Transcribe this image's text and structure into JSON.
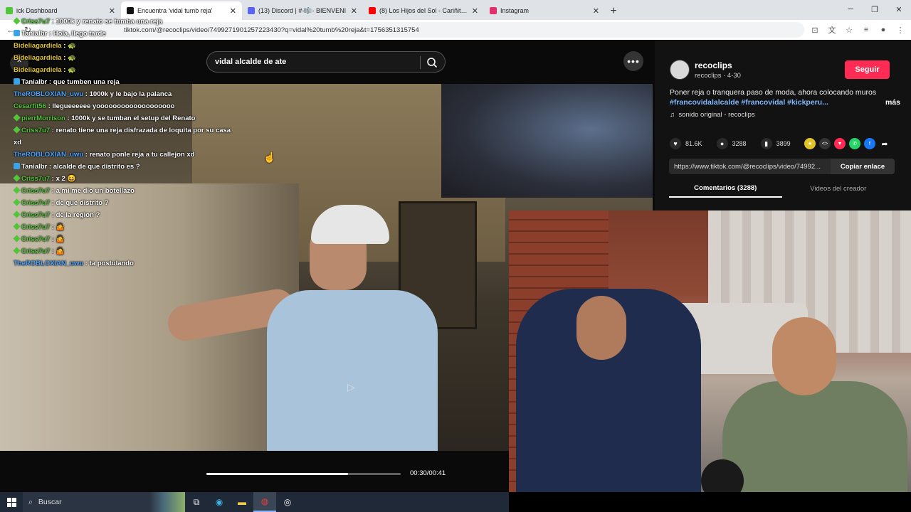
{
  "browser": {
    "tabs": [
      {
        "title": "ick Dashboard",
        "icon_color": "#53c53a",
        "active": false
      },
      {
        "title": "Encuentra 'vidal tumb reja'",
        "icon_color": "#111111",
        "active": true
      },
      {
        "title": "(13) Discord | #-🎼- BIENVENI",
        "icon_color": "#5865f2",
        "active": false
      },
      {
        "title": "(8) Los Hijos del Sol - Cariñito -",
        "icon_color": "#ff0000",
        "active": false
      },
      {
        "title": "Instagram",
        "icon_color": "#e1306c",
        "active": false
      }
    ],
    "url": "tiktok.com/@recoclips/video/7499271901257223430?q=vidal%20tumb%20reja&t=1756351315754"
  },
  "search": {
    "query": "vidal alcalde de ate"
  },
  "chat": [
    {
      "user": "Criss7u7",
      "text": "1000k y renato se tumba una reja",
      "user_color": "#53c53a",
      "badge": "g"
    },
    {
      "user": "Tanialbr",
      "text": "Hola, llego tarde",
      "user_color": "#ffffff",
      "badge": "b"
    },
    {
      "user": "Bideliagardiela",
      "text": "🐢",
      "user_color": "#e2c229",
      "badge": ""
    },
    {
      "user": "Bideliagardiela",
      "text": "🐢",
      "user_color": "#e2c229",
      "badge": ""
    },
    {
      "user": "Bideliagardiela",
      "text": "🐢",
      "user_color": "#e2c229",
      "badge": ""
    },
    {
      "user": "Tanialbr",
      "text": "que tumben una reja",
      "user_color": "#ffffff",
      "badge": "b"
    },
    {
      "user": "TheROBLOXIAN_uwu",
      "text": "1000k y le bajo la palanca",
      "user_color": "#4aa3ff",
      "badge": ""
    },
    {
      "user": "Cesarfit56",
      "text": "llegueeeeee yooooooooooooooooooo",
      "user_color": "#53c53a",
      "badge": ""
    },
    {
      "user": "pierrMorrison",
      "text": "1000k y se tumban el setup del Renato",
      "user_color": "#53c53a",
      "badge": "g"
    },
    {
      "user": "Criss7u7",
      "text": "renato tiene una reja disfrazada de loquita por su casa xd",
      "user_color": "#53c53a",
      "badge": "g"
    },
    {
      "user": "TheROBLOXIAN_uwu",
      "text": "renato ponle reja a tu callejon xd",
      "user_color": "#4aa3ff",
      "badge": ""
    },
    {
      "user": "Tanialbr",
      "text": "alcalde de que distrito es ?",
      "user_color": "#ffffff",
      "badge": "b"
    },
    {
      "user": "Criss7u7",
      "text": "x 2 😆",
      "user_color": "#53c53a",
      "badge": "g"
    },
    {
      "user": "Criss7u7",
      "text": "a mi me dio un botellazo",
      "user_color": "#53c53a",
      "badge": "g"
    },
    {
      "user": "Criss7u7",
      "text": "de que distrito ?",
      "user_color": "#53c53a",
      "badge": "g"
    },
    {
      "user": "Criss7u7",
      "text": "de la region ?",
      "user_color": "#53c53a",
      "badge": "g"
    },
    {
      "user": "Criss7u7",
      "text": "🤷",
      "user_color": "#53c53a",
      "badge": "g"
    },
    {
      "user": "Criss7u7",
      "text": "🤷",
      "user_color": "#53c53a",
      "badge": "g"
    },
    {
      "user": "Criss7u7",
      "text": "🤷",
      "user_color": "#53c53a",
      "badge": "g"
    },
    {
      "user": "TheROBLOXIAN_uwu",
      "text": "ta postulando",
      "user_color": "#4aa3ff",
      "badge": ""
    }
  ],
  "player": {
    "time": "00:30/00:41",
    "progress": 0.73
  },
  "creator": {
    "name": "recoclips",
    "meta": "recoclips · 4-30",
    "follow_label": "Seguir",
    "description": "Poner reja o tranquera paso de moda, ahora colocando muros",
    "hashtags": "#francovidalalcalde #francovidal #kickperu...",
    "more_label": "más",
    "sound": "sonido original - recoclips"
  },
  "stats": {
    "likes": "81.6K",
    "comments": "3288",
    "saves": "3899"
  },
  "link": {
    "url": "https://www.tiktok.com/@recoclips/video/74992...",
    "copy_label": "Copiar enlace"
  },
  "panel_tabs": {
    "comments": "Comentarios (3288)",
    "creator_videos": "Videos del creador"
  },
  "taskbar": {
    "search_label": "Buscar"
  }
}
